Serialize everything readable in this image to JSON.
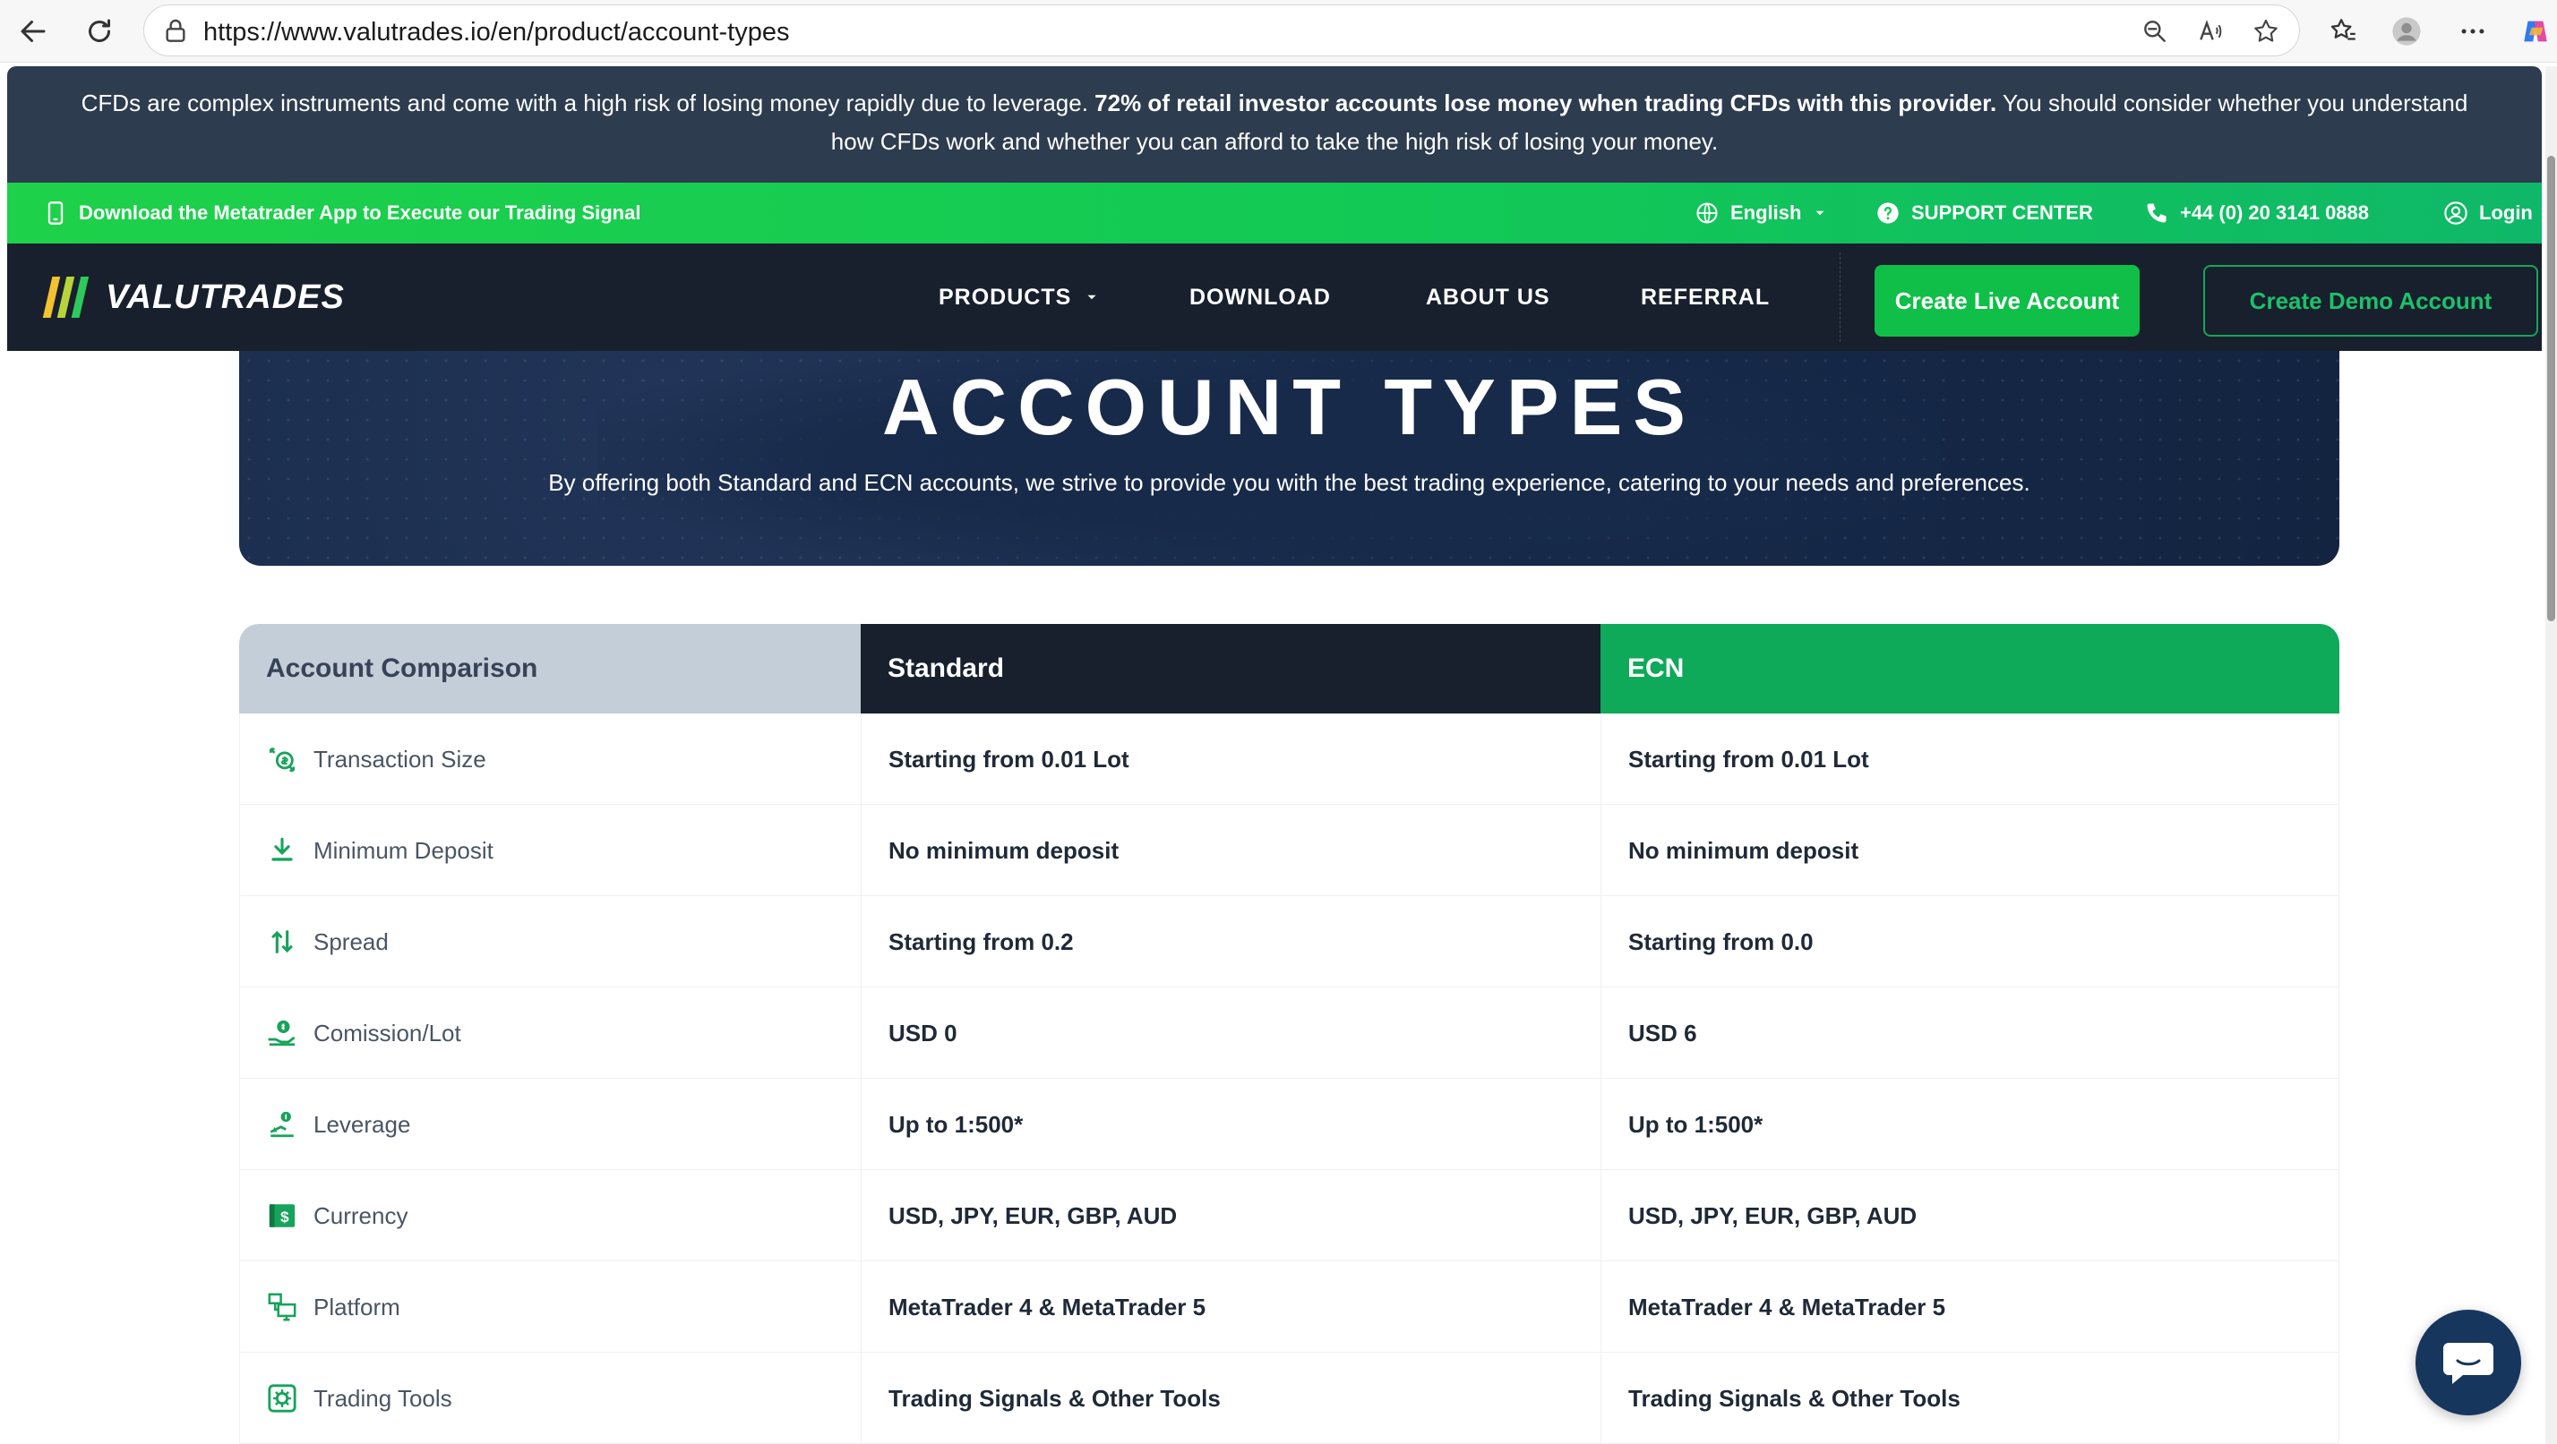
{
  "browser": {
    "url": "https://www.valutrades.io/en/product/account-types"
  },
  "risk_banner": {
    "text_before": "CFDs are complex instruments and come with a high risk of losing money rapidly due to leverage. ",
    "text_bold": "72% of retail investor accounts lose money when trading CFDs with this provider.",
    "text_after": " You should consider whether you understand how CFDs work and whether you can afford to take the high risk of losing your money."
  },
  "top_bar": {
    "download_app": "Download the Metatrader App to Execute our Trading Signal",
    "language": "English",
    "support": "SUPPORT CENTER",
    "phone": "+44 (0) 20 3141 0888",
    "login": "Login"
  },
  "nav": {
    "logo_text": "VALUTRADES",
    "products": "PRODUCTS",
    "download": "DOWNLOAD",
    "about": "ABOUT US",
    "referral": "REFERRAL",
    "create_live": "Create Live Account",
    "create_demo": "Create Demo Account"
  },
  "hero": {
    "title": "ACCOUNT TYPES",
    "subtitle": "By offering both Standard and ECN accounts, we strive to provide you with the best trading experience, catering to your needs and preferences."
  },
  "table": {
    "headers": {
      "label": "Account Comparison",
      "standard": "Standard",
      "ecn": "ECN"
    },
    "rows": [
      {
        "icon": "coins-exchange-icon",
        "label": "Transaction Size",
        "standard": "Starting from 0.01 Lot",
        "ecn": "Starting from 0.01 Lot"
      },
      {
        "icon": "deposit-icon",
        "label": "Minimum Deposit",
        "standard": "No minimum deposit",
        "ecn": "No minimum deposit"
      },
      {
        "icon": "spread-arrows-icon",
        "label": "Spread",
        "standard": "Starting from 0.2",
        "ecn": "Starting from 0.0"
      },
      {
        "icon": "commission-hand-icon",
        "label": "Comission/Lot",
        "standard": "USD 0",
        "ecn": "USD 6"
      },
      {
        "icon": "leverage-icon",
        "label": "Leverage",
        "standard": "Up to 1:500*",
        "ecn": "Up to 1:500*"
      },
      {
        "icon": "currency-note-icon",
        "label": "Currency",
        "standard": "USD, JPY, EUR, GBP, AUD",
        "ecn": "USD, JPY, EUR, GBP, AUD"
      },
      {
        "icon": "platform-icon",
        "label": "Platform",
        "standard": "MetaTrader 4 & MetaTrader 5",
        "ecn": "MetaTrader 4 & MetaTrader 5"
      },
      {
        "icon": "tools-gear-icon",
        "label": "Trading Tools",
        "standard": "Trading Signals & Other Tools",
        "ecn": "Trading Signals & Other Tools"
      }
    ]
  },
  "colors": {
    "banner_bg": "#2d3c4e",
    "green_bar": "#12c955",
    "nav_bg": "#17202c",
    "accent_green": "#0ea959",
    "hero_bg": "#172a4a"
  }
}
